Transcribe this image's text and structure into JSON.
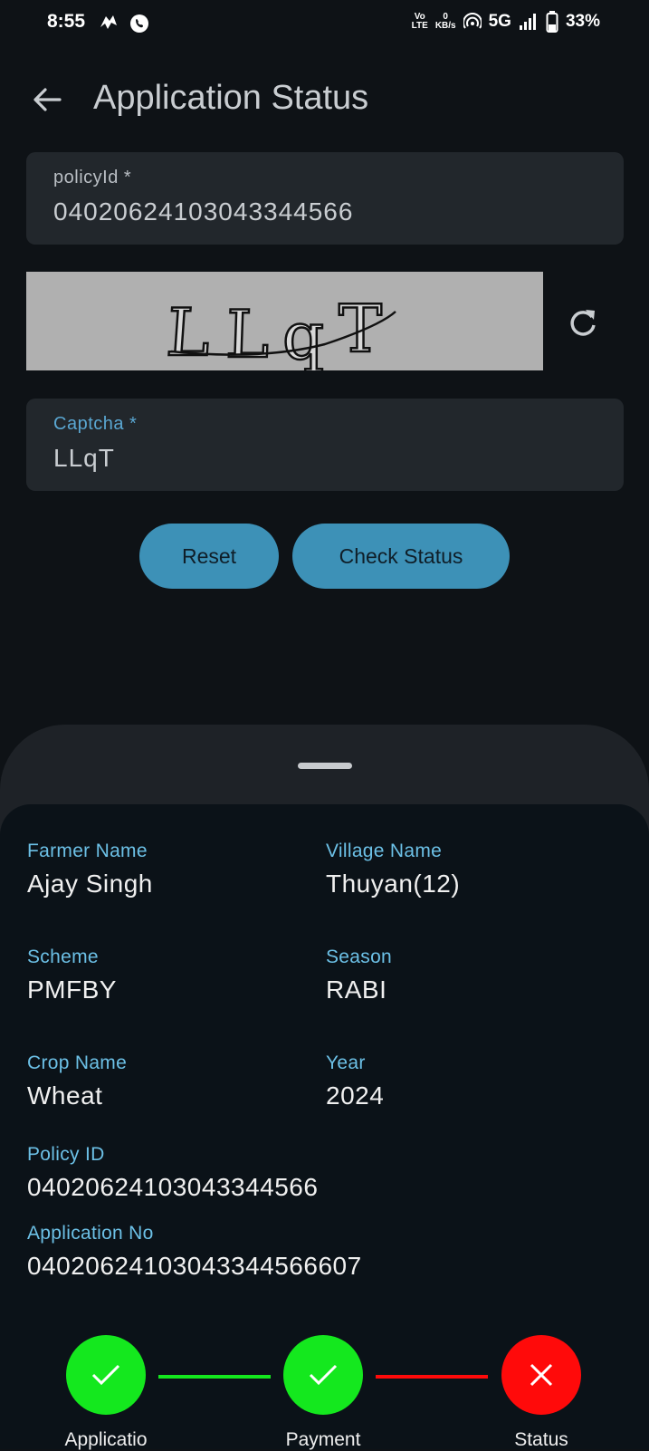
{
  "status_bar": {
    "time": "8:55",
    "network_label_top": "Vo",
    "network_label_bottom": "LTE",
    "speed_value": "0",
    "speed_unit": "KB/s",
    "network_type": "5G",
    "battery": "33%"
  },
  "header": {
    "title": "Application Status",
    "back_icon": "arrow-left-icon"
  },
  "form": {
    "policy_label": "policyId *",
    "policy_value": "04020624103043344566",
    "captcha_image_text": "LLqT",
    "refresh_icon": "refresh-icon",
    "captcha_label": "Captcha *",
    "captcha_value": "LLqT",
    "reset_label": "Reset",
    "check_status_label": "Check Status"
  },
  "details": {
    "farmer_name_label": "Farmer Name",
    "farmer_name_value": "Ajay Singh",
    "village_name_label": "Village Name",
    "village_name_value": "Thuyan(12)",
    "scheme_label": "Scheme",
    "scheme_value": "PMFBY",
    "season_label": "Season",
    "season_value": "RABI",
    "crop_name_label": "Crop Name",
    "crop_name_value": "Wheat",
    "year_label": "Year",
    "year_value": "2024",
    "policy_id_label": "Policy ID",
    "policy_id_value": "04020624103043344566",
    "application_no_label": "Application No",
    "application_no_value": "04020624103043344566607"
  },
  "progress": {
    "steps": [
      {
        "label": "Applicatio",
        "state": "done",
        "icon": "check-icon"
      },
      {
        "label": "Payment",
        "state": "done",
        "icon": "check-icon"
      },
      {
        "label": "Status",
        "state": "failed",
        "icon": "close-icon"
      }
    ],
    "colors": {
      "done": "#14e81e",
      "failed": "#ff0a0a"
    }
  }
}
